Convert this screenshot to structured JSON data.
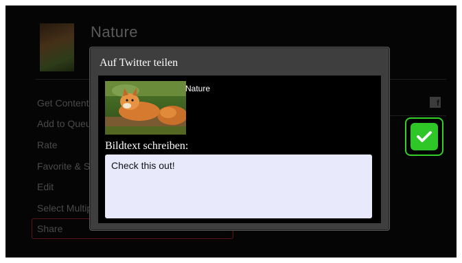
{
  "background": {
    "title": "Nature",
    "menu_items": [
      {
        "label": "Get Content"
      },
      {
        "label": "Add to Queue"
      },
      {
        "label": "Rate"
      },
      {
        "label": "Favorite & Share"
      },
      {
        "label": "Edit"
      },
      {
        "label": "Select Multiple"
      },
      {
        "label": "Share"
      }
    ],
    "selected_item": "Share"
  },
  "dialog": {
    "title": "Auf Twitter teilen",
    "image_title": "Nature",
    "image_icon": "fox-photo",
    "caption_label": "Bildtext schreiben:",
    "caption_value": "Check this out!"
  },
  "confirm_button": {
    "icon": "checkmark-icon",
    "color": "#2fc628"
  },
  "colors": {
    "accent_green": "#33d12a",
    "selected_border": "#5a1414",
    "dialog_bg": "#3e3e3e",
    "input_bg": "#e8e9fb"
  }
}
